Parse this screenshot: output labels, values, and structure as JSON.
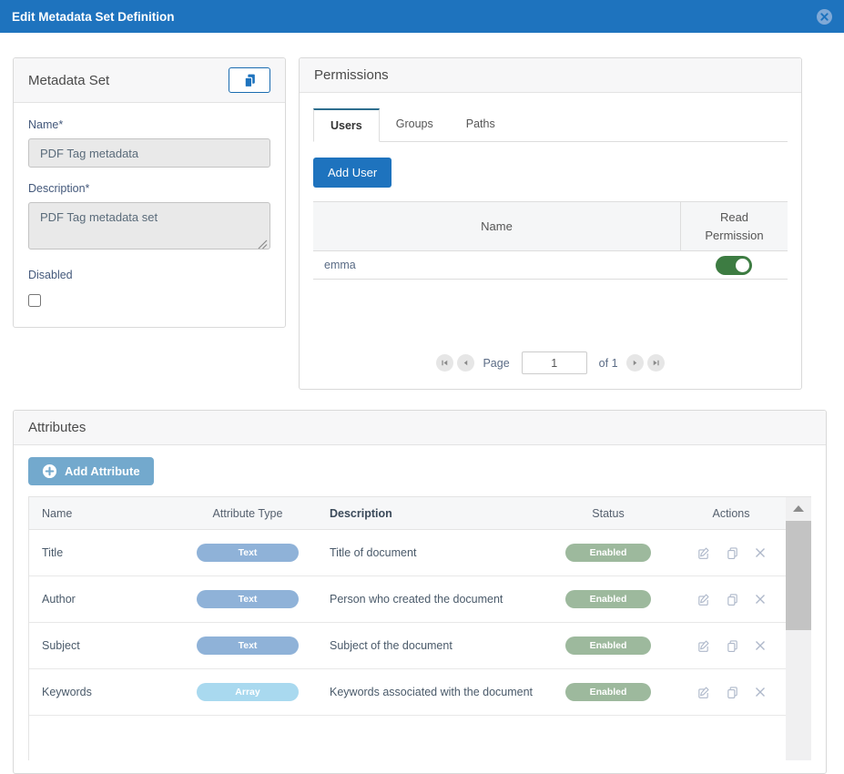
{
  "titlebar": {
    "title": "Edit Metadata Set Definition"
  },
  "metadata_set": {
    "title": "Metadata Set",
    "name_label": "Name*",
    "name_value": "PDF Tag metadata",
    "description_label": "Description*",
    "description_value": "PDF Tag metadata set",
    "disabled_label": "Disabled",
    "disabled_checked": false
  },
  "permissions": {
    "title": "Permissions",
    "tabs": [
      {
        "label": "Users",
        "active": true
      },
      {
        "label": "Groups",
        "active": false
      },
      {
        "label": "Paths",
        "active": false
      }
    ],
    "add_user_label": "Add User",
    "table": {
      "columns": [
        "Name",
        "Read Permission"
      ],
      "rows": [
        {
          "name": "emma",
          "read_permission": true
        }
      ]
    },
    "pagination": {
      "page_label": "Page",
      "page_value": "1",
      "of_label": "of 1"
    }
  },
  "attributes": {
    "title": "Attributes",
    "add_attribute_label": "Add Attribute",
    "table": {
      "columns": [
        "Name",
        "Attribute Type",
        "Description",
        "Status",
        "Actions"
      ],
      "rows": [
        {
          "name": "Title",
          "type": "Text",
          "description": "Title of document",
          "status": "Enabled"
        },
        {
          "name": "Author",
          "type": "Text",
          "description": "Person who created the document",
          "status": "Enabled"
        },
        {
          "name": "Subject",
          "type": "Text",
          "description": "Subject of the document",
          "status": "Enabled"
        },
        {
          "name": "Keywords",
          "type": "Array",
          "description": "Keywords associated with the document",
          "status": "Enabled"
        }
      ]
    }
  },
  "colors": {
    "titlebar_blue": "#1e73be",
    "primary_button_blue": "#1e73be",
    "add_attribute_blue": "#73a9cd",
    "active_tab_accent": "#2e6e8e",
    "type_pill_text": "#8fb2d8",
    "type_pill_array": "#a9d9ef",
    "status_pill_enabled": "#9db99d",
    "toggle_on_green": "#3d7c42"
  }
}
